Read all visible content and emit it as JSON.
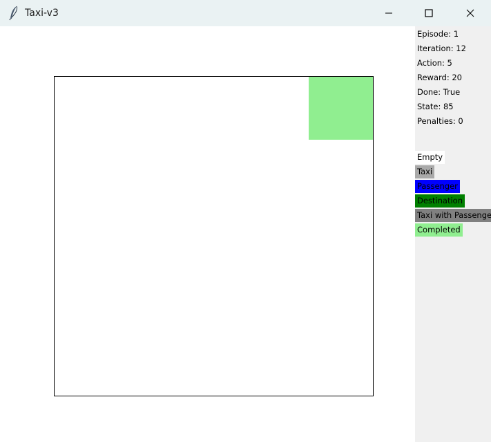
{
  "window": {
    "title": "Taxi-v3"
  },
  "icons": {
    "app": "feather-icon",
    "minimize": "minimize-icon",
    "maximize": "maximize-icon",
    "close": "close-icon"
  },
  "grid": {
    "completed_color": "#90ee90",
    "border_color": "#000000",
    "background": "#ffffff"
  },
  "stats": [
    {
      "text": "Episode: 1"
    },
    {
      "text": "Iteration: 12"
    },
    {
      "text": "Action: 5"
    },
    {
      "text": "Reward: 20"
    },
    {
      "text": "Done: True"
    },
    {
      "text": "State: 85"
    },
    {
      "text": "Penalties: 0"
    }
  ],
  "legend": [
    {
      "label": "Empty",
      "color": "#ffffff"
    },
    {
      "label": "Taxi",
      "color": "#a9a9a9"
    },
    {
      "label": "Passenger",
      "color": "#0000ff"
    },
    {
      "label": "Destination",
      "color": "#008000"
    },
    {
      "label": "Taxi with Passenger",
      "color": "#808080"
    },
    {
      "label": "Completed",
      "color": "#90ee90"
    }
  ]
}
